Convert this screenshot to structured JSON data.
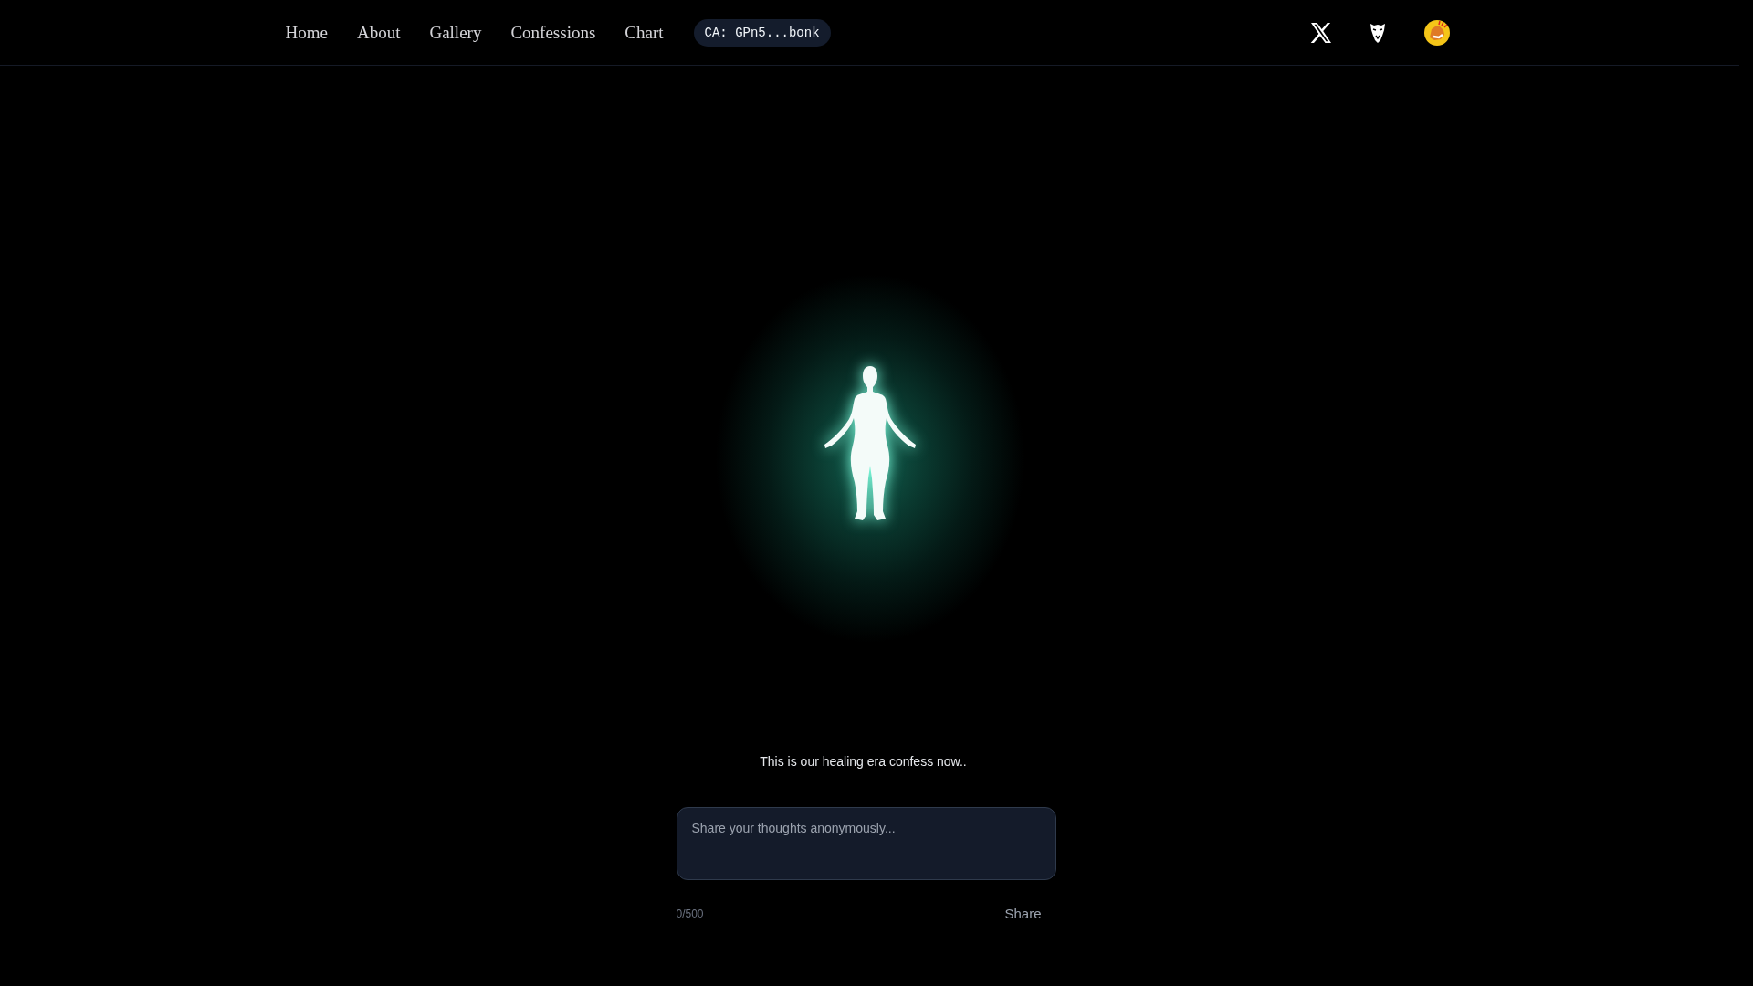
{
  "nav": {
    "links": [
      {
        "label": "Home"
      },
      {
        "label": "About"
      },
      {
        "label": "Gallery"
      },
      {
        "label": "Confessions"
      },
      {
        "label": "Chart"
      }
    ],
    "contract": "CA: GPn5...bonk"
  },
  "hero": {
    "caption": "This is our healing era confess now.."
  },
  "form": {
    "placeholder": "Share your thoughts anonymously...",
    "counter": "0/500",
    "submit": "Share"
  }
}
